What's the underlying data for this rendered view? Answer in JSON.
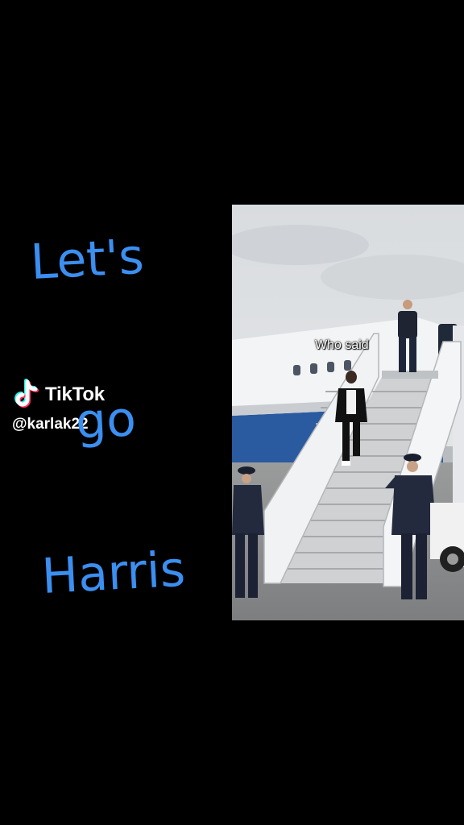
{
  "caption": {
    "words": [
      "Let's",
      "go",
      "Harris"
    ],
    "color": "#3b8ff0"
  },
  "watermark": {
    "brand": "TikTok",
    "username": "@karlak22",
    "logo_icon": "tiktok-logo-icon"
  },
  "video": {
    "overlay_text": "Who said"
  },
  "colors": {
    "background": "#000000",
    "caption_blue": "#3b8ff0",
    "tiktok_cyan": "#25f4ee",
    "tiktok_red": "#fe2c55"
  }
}
